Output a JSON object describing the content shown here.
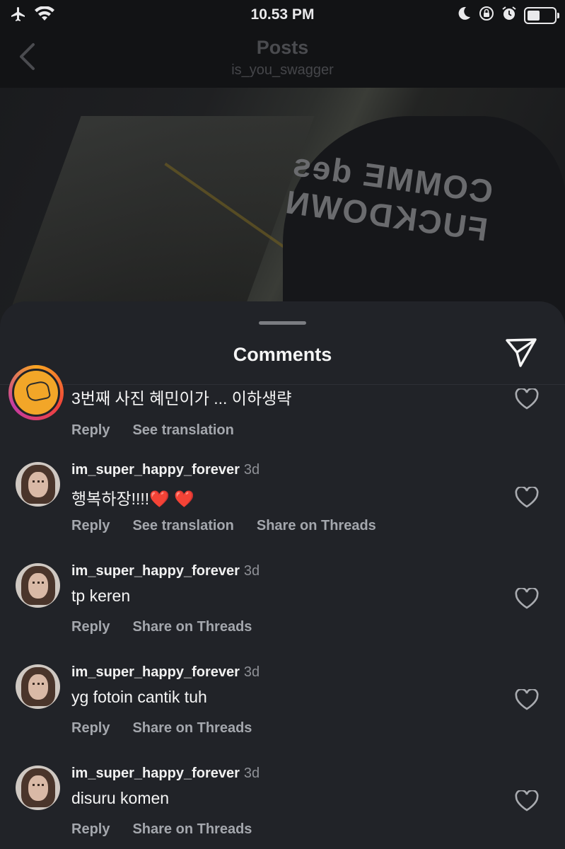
{
  "status_bar": {
    "time": "10.53 PM"
  },
  "nav": {
    "title": "Posts",
    "subtitle": "is_you_swagger"
  },
  "photo_text": [
    "COMME des",
    "FUCKDOWN"
  ],
  "sheet": {
    "title": "Comments"
  },
  "comments": [
    {
      "username": "",
      "time": "",
      "text": "3번째 사진 혜민이가 ... 이하생략",
      "actions": [
        "Reply",
        "See translation"
      ]
    },
    {
      "username": "im_super_happy_forever",
      "time": "3d",
      "text": "행복하장!!!!❤️ ❤️",
      "actions": [
        "Reply",
        "See translation",
        "Share on Threads"
      ]
    },
    {
      "username": "im_super_happy_forever",
      "time": "3d",
      "text": "tp keren",
      "actions": [
        "Reply",
        "Share on Threads"
      ]
    },
    {
      "username": "im_super_happy_forever",
      "time": "3d",
      "text": "yg fotoin cantik tuh",
      "actions": [
        "Reply",
        "Share on Threads"
      ]
    },
    {
      "username": "im_super_happy_forever",
      "time": "3d",
      "text": "disuru komen",
      "actions": [
        "Reply",
        "Share on Threads"
      ]
    }
  ],
  "colors": {
    "sheet_bg": "#212328",
    "action_text": "#a4a7ad",
    "heart_red": "#e8423a"
  },
  "icons": [
    "airplane-icon",
    "wifi-icon",
    "moon-icon",
    "rotation-lock-icon",
    "alarm-icon",
    "battery-icon",
    "back-chevron-icon",
    "send-icon",
    "heart-icon"
  ]
}
